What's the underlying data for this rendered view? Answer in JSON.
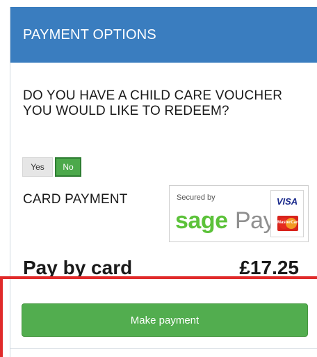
{
  "panel": {
    "title": "PAYMENT OPTIONS"
  },
  "voucher": {
    "question": "DO YOU HAVE A CHILD CARE VOUCHER YOU WOULD LIKE TO REDEEM?",
    "yes_label": "Yes",
    "no_label": "No",
    "selected": "No"
  },
  "card_payment": {
    "label": "CARD PAYMENT",
    "badge": {
      "secured_by": "Secured by",
      "brand_primary": "sage",
      "brand_secondary": "Pay",
      "card_visa": "VISA",
      "card_mastercard": "MasterCard"
    }
  },
  "summary": {
    "label": "Pay by card",
    "amount": "£17.25"
  },
  "actions": {
    "make_payment": "Make payment"
  },
  "colors": {
    "header_bg": "#3a7dbf",
    "button_green": "#52ad4f",
    "highlight_red": "#e02a2a",
    "sage_green": "#5cc23a"
  }
}
